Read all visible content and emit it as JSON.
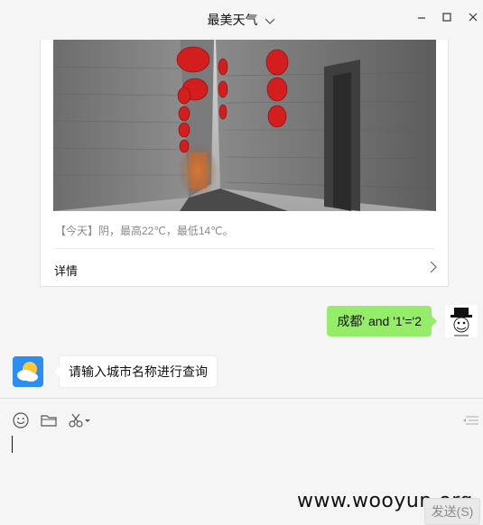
{
  "window": {
    "title": "最美天气"
  },
  "card": {
    "summary": "【今天】阴，最高22℃，最低14℃。",
    "details_label": "详情"
  },
  "messages": {
    "outgoing_text": "成都' and '1'='2",
    "incoming_text": "请输入城市名称进行查询"
  },
  "input": {
    "value": "",
    "send_label": "发送(S)"
  },
  "watermark": "www.wooyun.org",
  "colors": {
    "outgoing_bubble": "#95ec69",
    "bot_avatar": "#2a8ef3"
  },
  "icons": [
    "chevron-down-icon",
    "minimize-icon",
    "maximize-icon",
    "close-icon",
    "chevron-right-icon",
    "emoji-icon",
    "folder-icon",
    "scissors-icon",
    "history-icon"
  ]
}
